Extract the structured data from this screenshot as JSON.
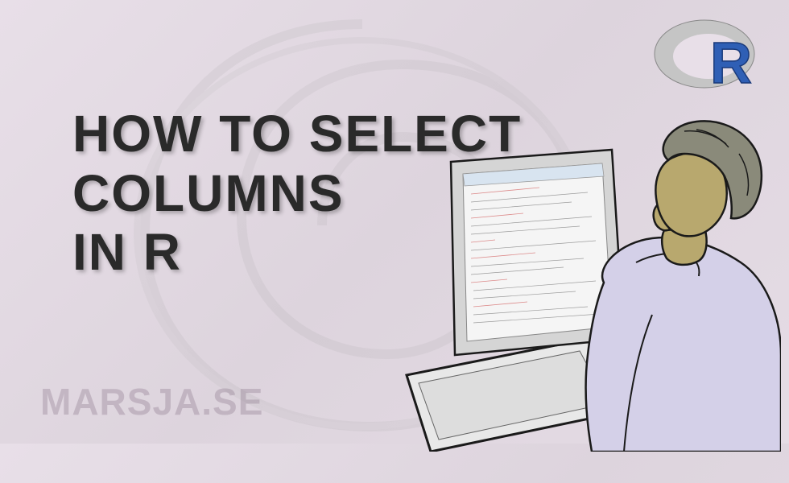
{
  "title": {
    "line1": "HOW TO SELECT",
    "line2": "COLUMNS",
    "line3": "IN R"
  },
  "watermark": "MARSJA.SE",
  "logo": {
    "letter": "R"
  }
}
